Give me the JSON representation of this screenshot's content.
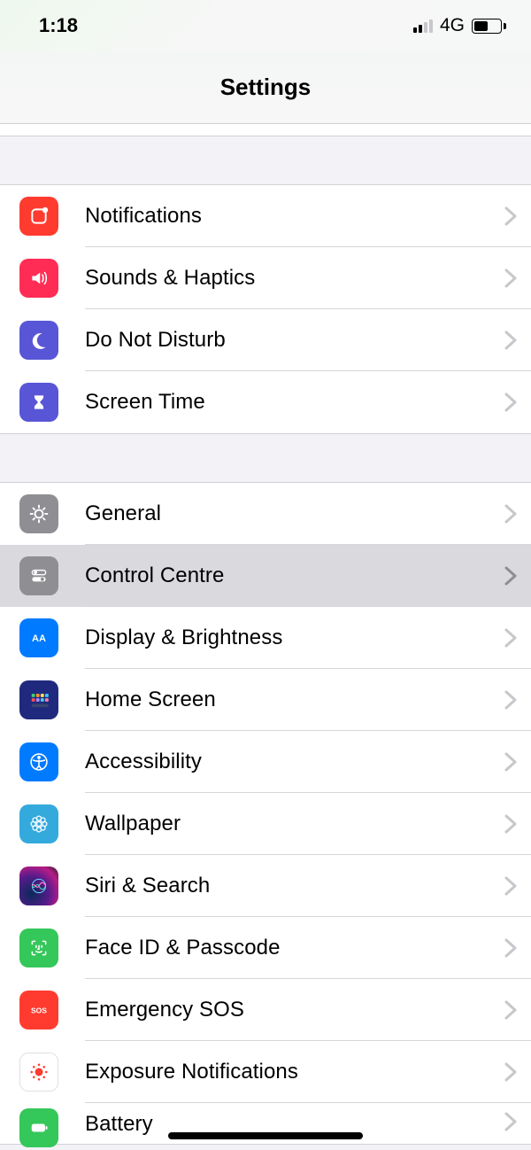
{
  "status": {
    "time": "1:18",
    "signal_active_bars": 2,
    "network_label": "4G",
    "battery_pct": 55
  },
  "nav": {
    "title": "Settings"
  },
  "sections": [
    {
      "rows": [
        {
          "id": "notifications",
          "label": "Notifications",
          "icon": "notifications-icon",
          "bg": "bg-red"
        },
        {
          "id": "sounds",
          "label": "Sounds & Haptics",
          "icon": "sounds-icon",
          "bg": "bg-pink"
        },
        {
          "id": "dnd",
          "label": "Do Not Disturb",
          "icon": "moon-icon",
          "bg": "bg-indigo"
        },
        {
          "id": "screentime",
          "label": "Screen Time",
          "icon": "hourglass-icon",
          "bg": "bg-indigo"
        }
      ]
    },
    {
      "rows": [
        {
          "id": "general",
          "label": "General",
          "icon": "gear-icon",
          "bg": "bg-gray"
        },
        {
          "id": "controlcentre",
          "label": "Control Centre",
          "icon": "switches-icon",
          "bg": "bg-gray",
          "pressed": true
        },
        {
          "id": "display",
          "label": "Display & Brightness",
          "icon": "aa-icon",
          "bg": "bg-blue"
        },
        {
          "id": "homescreen",
          "label": "Home Screen",
          "icon": "grid-icon",
          "bg": "bg-darkblue"
        },
        {
          "id": "accessibility",
          "label": "Accessibility",
          "icon": "accessibility-icon",
          "bg": "bg-blue"
        },
        {
          "id": "wallpaper",
          "label": "Wallpaper",
          "icon": "flower-icon",
          "bg": "bg-cyan"
        },
        {
          "id": "siri",
          "label": "Siri & Search",
          "icon": "siri-icon",
          "bg": "bg-gradient-dark"
        },
        {
          "id": "faceid",
          "label": "Face ID & Passcode",
          "icon": "faceid-icon",
          "bg": "bg-green"
        },
        {
          "id": "sos",
          "label": "Emergency SOS",
          "icon": "sos-icon",
          "bg": "bg-red"
        },
        {
          "id": "exposure",
          "label": "Exposure Notifications",
          "icon": "exposure-icon",
          "bg": "bg-white-card"
        },
        {
          "id": "battery",
          "label": "Battery",
          "icon": "battery-icon",
          "bg": "bg-green"
        }
      ]
    }
  ]
}
